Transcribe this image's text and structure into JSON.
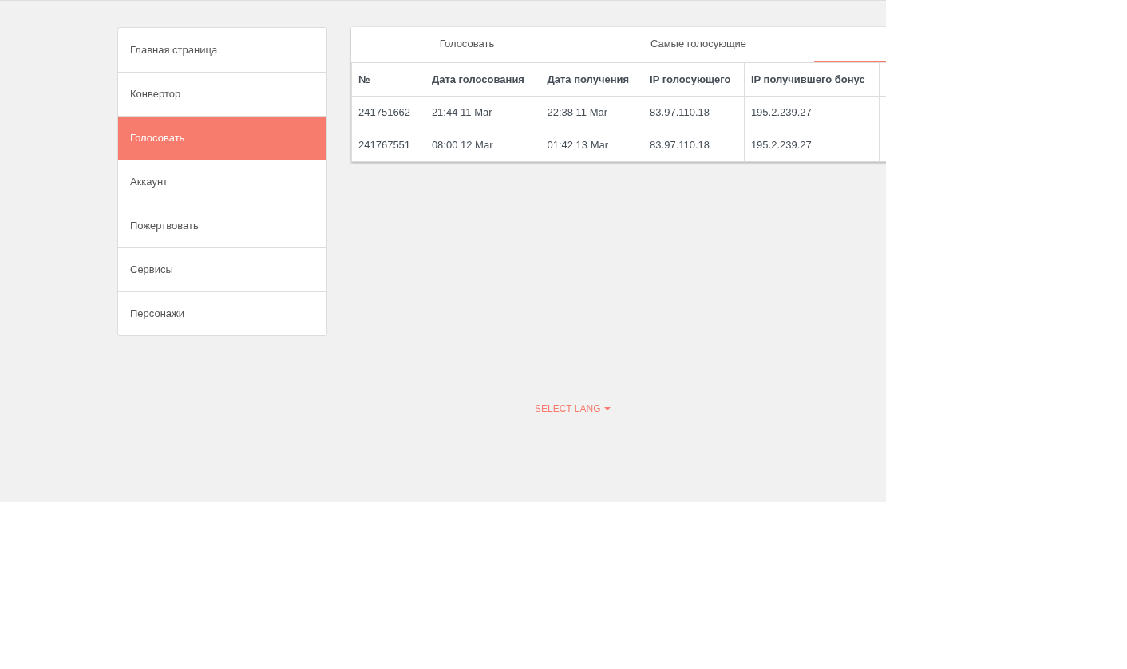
{
  "sidebar": {
    "items": [
      {
        "label": "Главная страница",
        "selected": false
      },
      {
        "label": "Конвертор",
        "selected": false
      },
      {
        "label": "Голосовать",
        "selected": true
      },
      {
        "label": "Аккаунт",
        "selected": false
      },
      {
        "label": "Пожертвовать",
        "selected": false
      },
      {
        "label": "Сервисы",
        "selected": false
      },
      {
        "label": "Персонажи",
        "selected": false
      }
    ]
  },
  "tabs": [
    {
      "label": "Голосовать",
      "selected": false
    },
    {
      "label": "Самые голосующие",
      "selected": false
    },
    {
      "selected": true
    }
  ],
  "table": {
    "columns": [
      "№",
      "Дата голосования",
      "Дата получения",
      "IP голосующего",
      "IP получившего бонус"
    ],
    "rows": [
      [
        "241751662",
        "21:44 11 Mar",
        "22:38 11 Mar",
        "83.97.110.18",
        "195.2.239.27"
      ],
      [
        "241767551",
        "08:00 12 Mar",
        "01:42 13 Mar",
        "83.97.110.18",
        "195.2.239.27"
      ]
    ]
  },
  "language_selector": {
    "label": "SELECT LANG"
  }
}
